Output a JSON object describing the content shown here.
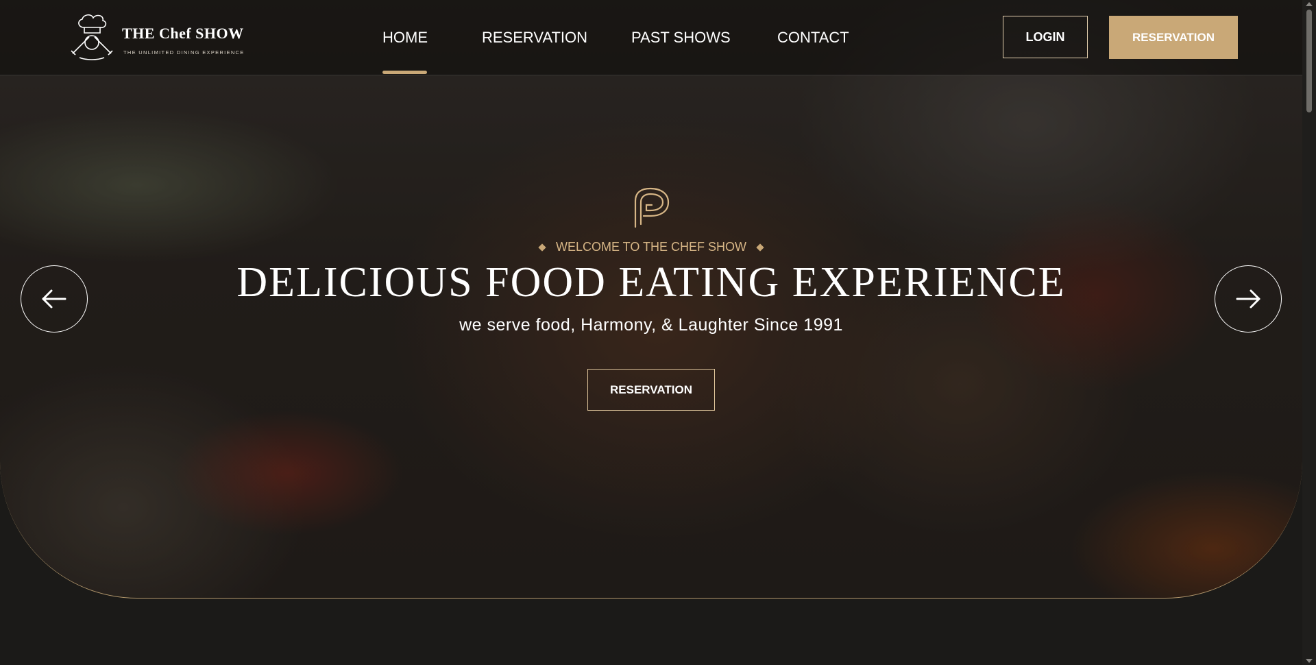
{
  "brand": {
    "title": "THE Chef SHOW",
    "tagline": "THE UNLIMITED DINING EXPERIENCE",
    "accent_color": "#c9a877"
  },
  "nav": {
    "items": [
      {
        "label": "HOME",
        "active": true
      },
      {
        "label": "RESERVATION",
        "active": false
      },
      {
        "label": "PAST SHOWS",
        "active": false
      },
      {
        "label": "CONTACT",
        "active": false
      }
    ]
  },
  "header_buttons": {
    "login_label": "LOGIN",
    "reservation_label": "RESERVATION"
  },
  "hero": {
    "icon": "brand-emblem-icon",
    "welcome": "WELCOME TO THE CHEF SHOW",
    "headline": "DELICIOUS FOOD EATING EXPERIENCE",
    "subline": "we serve food, Harmony, & Laughter Since 1991",
    "cta_label": "RESERVATION",
    "prev_icon": "arrow-left-icon",
    "next_icon": "arrow-right-icon"
  }
}
